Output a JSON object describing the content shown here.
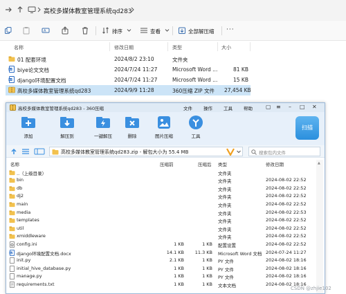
{
  "explorer": {
    "breadcrumb": "高校多媒体教室管理系统qd283",
    "toolbar": {
      "sort_label": "排序",
      "view_label": "查看",
      "extract_all_label": "全部解压缩"
    },
    "columns": [
      "名称",
      "修改日期",
      "类型",
      "大小"
    ],
    "rows": [
      {
        "name": "01 配套环境",
        "date": "2024/8/2 23:10",
        "type": "文件夹",
        "size": "",
        "icon": "folder-icon",
        "selected": false
      },
      {
        "name": "biye论文文档",
        "date": "2024/7/24 11:27",
        "type": "Microsoft Word ...",
        "size": "81 KB",
        "icon": "word-doc-icon",
        "selected": false
      },
      {
        "name": "django环境配置文档",
        "date": "2024/7/24 11:27",
        "type": "Microsoft Word ...",
        "size": "15 KB",
        "icon": "word-doc-icon",
        "selected": false
      },
      {
        "name": "高校多媒体教室管理系统qd283",
        "date": "2024/9/9 11:28",
        "type": "360压缩 ZIP 文件",
        "size": "27,454 KB",
        "icon": "zip-icon",
        "selected": true
      }
    ]
  },
  "zip_window": {
    "title": "高校多媒体教室管理系统qd283 - 360压缩",
    "menu": [
      "文件",
      "操作",
      "工具",
      "帮助"
    ],
    "tools": [
      {
        "label": "添加",
        "icon": "add-icon"
      },
      {
        "label": "解压到",
        "icon": "extract-to-icon"
      },
      {
        "label": "一键解压",
        "icon": "one-click-extract-icon"
      },
      {
        "label": "删除",
        "icon": "delete-icon"
      },
      {
        "label": "图片压缩",
        "icon": "image-compress-icon"
      },
      {
        "label": "工具",
        "icon": "tools-icon"
      }
    ],
    "scan_label": "扫描",
    "address": "高校多媒体教室管理系统qd283.zip - 解包大小为 55.4 MB",
    "search_placeholder": "搜索包内文件",
    "columns": [
      "名称",
      "压缩前",
      "压缩后",
      "类型",
      "修改日期"
    ],
    "rows": [
      {
        "name": "..（上级目录）",
        "before": "",
        "after": "",
        "type": "文件夹",
        "date": "",
        "icon": "folder-icon"
      },
      {
        "name": "bin",
        "before": "",
        "after": "",
        "type": "文件夹",
        "date": "2024-08-02 22:52",
        "icon": "folder-icon"
      },
      {
        "name": "db",
        "before": "",
        "after": "",
        "type": "文件夹",
        "date": "2024-08-02 22:52",
        "icon": "folder-icon"
      },
      {
        "name": "dj2",
        "before": "",
        "after": "",
        "type": "文件夹",
        "date": "2024-08-02 22:52",
        "icon": "folder-icon"
      },
      {
        "name": "main",
        "before": "",
        "after": "",
        "type": "文件夹",
        "date": "2024-08-02 22:52",
        "icon": "folder-icon"
      },
      {
        "name": "media",
        "before": "",
        "after": "",
        "type": "文件夹",
        "date": "2024-08-02 22:53",
        "icon": "folder-icon"
      },
      {
        "name": "templates",
        "before": "",
        "after": "",
        "type": "文件夹",
        "date": "2024-08-02 22:52",
        "icon": "folder-icon"
      },
      {
        "name": "util",
        "before": "",
        "after": "",
        "type": "文件夹",
        "date": "2024-08-02 22:52",
        "icon": "folder-icon"
      },
      {
        "name": "xmiddleware",
        "before": "",
        "after": "",
        "type": "文件夹",
        "date": "2024-08-02 22:52",
        "icon": "folder-icon"
      },
      {
        "name": "config.ini",
        "before": "1 KB",
        "after": "1 KB",
        "type": "配置设置",
        "date": "2024-08-02 22:52",
        "icon": "config-file-icon"
      },
      {
        "name": "django环境配置文档.docx",
        "before": "14.1 KB",
        "after": "11.3 KB",
        "type": "Microsoft Word 文档",
        "date": "2024-07-24 11:27",
        "icon": "word-doc-icon"
      },
      {
        "name": "init.py",
        "before": "2.1 KB",
        "after": "1 KB",
        "type": "PY 文件",
        "date": "2024-08-02 18:16",
        "icon": "file-icon"
      },
      {
        "name": "initial_hive_database.py",
        "before": "1 KB",
        "after": "1 KB",
        "type": "PY 文件",
        "date": "2024-08-02 18:16",
        "icon": "file-icon"
      },
      {
        "name": "manage.py",
        "before": "1 KB",
        "after": "1 KB",
        "type": "PY 文件",
        "date": "2024-08-02 18:16",
        "icon": "file-icon"
      },
      {
        "name": "requirements.txt",
        "before": "1 KB",
        "after": "1 KB",
        "type": "文本文档",
        "date": "2024-08-02 18:16",
        "icon": "text-file-icon"
      }
    ]
  },
  "watermark": "CSDN @zhjie102",
  "colors": {
    "selection": "#cce4f7",
    "folder": "#f2c14e",
    "zip_toolbar_bg": "#e7f0fa",
    "accent_blue": "#2b8fdd"
  }
}
